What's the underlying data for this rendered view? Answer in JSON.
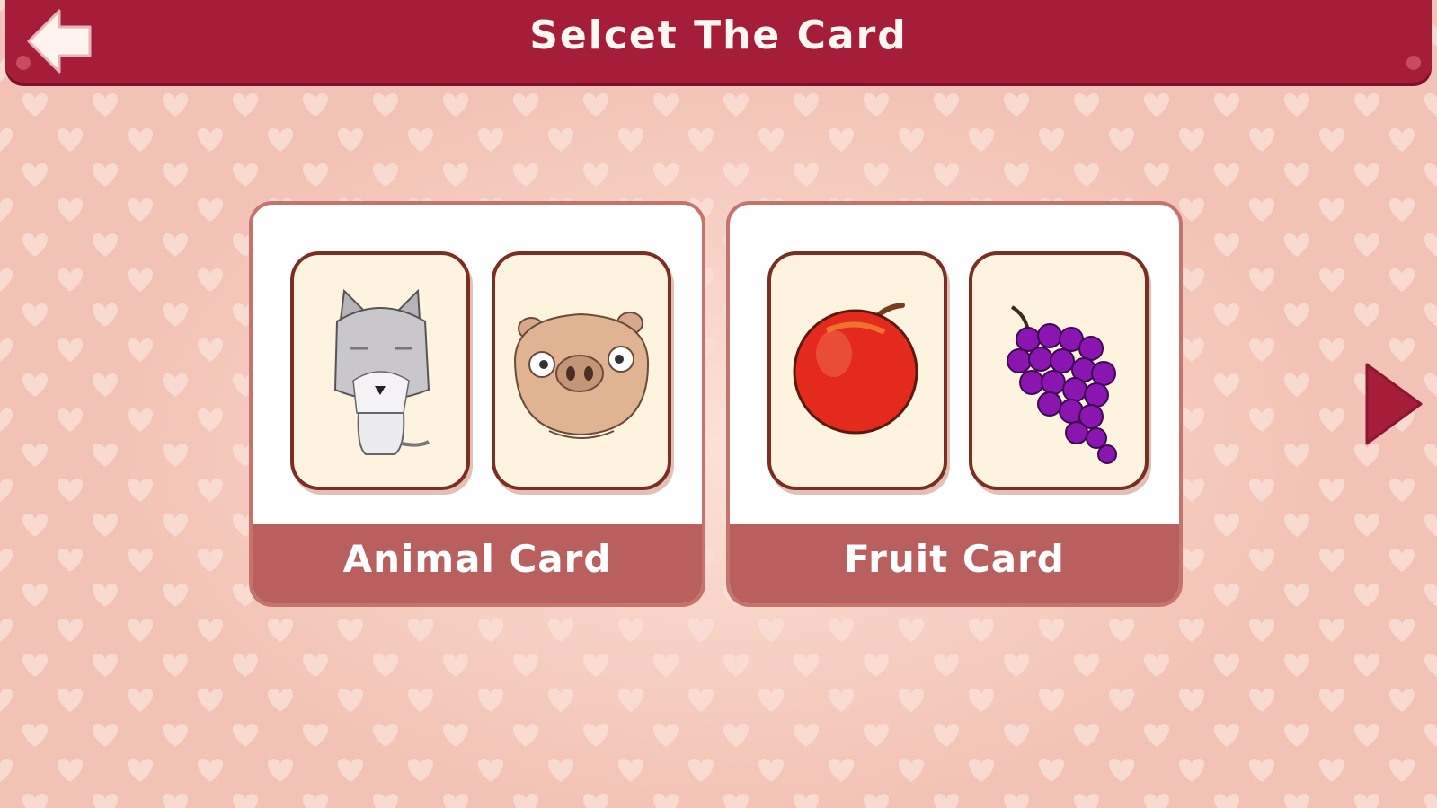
{
  "header": {
    "title": "Selcet The Card"
  },
  "decks": [
    {
      "label": "Animal Card",
      "tiles": [
        "wolf",
        "pig"
      ]
    },
    {
      "label": "Fruit Card",
      "tiles": [
        "apple",
        "grapes"
      ]
    }
  ],
  "icons": {
    "back": "back-arrow-icon",
    "next": "play-right-icon"
  },
  "colors": {
    "header": "#a61d3a",
    "background": "#f3c2b6",
    "deck_label_bar": "#b9605f",
    "tile_face": "#fdf3df"
  }
}
